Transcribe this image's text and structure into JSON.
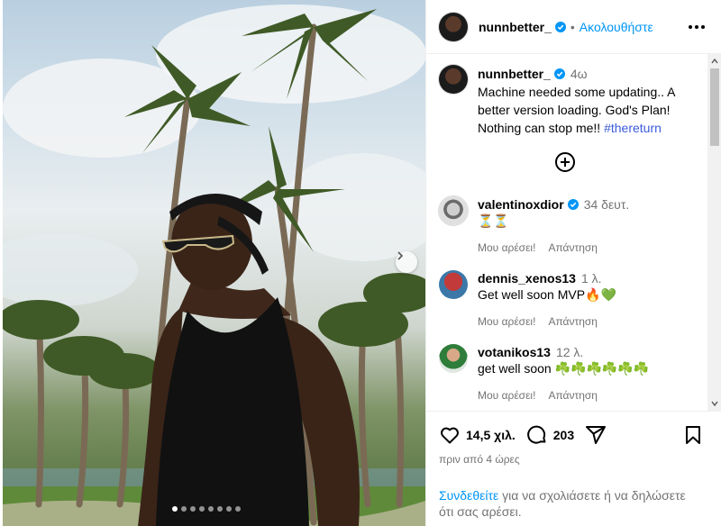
{
  "post": {
    "username": "nunnbetter_",
    "follow_label": "Ακολουθήστε",
    "follow_separator": "•",
    "caption": {
      "username": "nunnbetter_",
      "time": "4ω",
      "text": "Machine needed some updating.. A better version loading. God's Plan! Nothing can stop me!!",
      "hashtag": "#thereturn"
    },
    "carousel": {
      "slide_count": 8,
      "active_index": 0
    }
  },
  "comments": [
    {
      "username": "valentinoxdior",
      "verified": true,
      "time": "34 δευτ.",
      "text": "⏳⏳",
      "like_label": "Μου αρέσει!",
      "reply_label": "Απάντηση"
    },
    {
      "username": "dennis_xenos13",
      "verified": false,
      "time": "1 λ.",
      "text": "Get well soon MVP🔥💚",
      "like_label": "Μου αρέσει!",
      "reply_label": "Απάντηση"
    },
    {
      "username": "votanikos13",
      "verified": false,
      "time": "12 λ.",
      "text": "get well soon ☘️☘️☘️☘️☘️☘️",
      "like_label": "Μου αρέσει!",
      "reply_label": "Απάντηση"
    }
  ],
  "footer": {
    "likes": "14,5 χιλ.",
    "comments_count": "203",
    "posted_time": "πριν από 4 ώρες",
    "login_link": "Συνδεθείτε",
    "login_text": " για να σχολιάσετε ή να δηλώσετε ότι σας αρέσει."
  },
  "icons": {
    "like": "heart-icon",
    "comment": "comment-icon",
    "share": "paper-plane-icon",
    "save": "bookmark-icon",
    "more": "more-options-icon",
    "load_more": "plus-circle-icon",
    "next": "chevron-right-icon",
    "verified": "verified-badge-icon"
  },
  "colors": {
    "link": "#0095f6",
    "verified": "#0095f6",
    "muted": "#737373",
    "hashtag": "#3b5bdb"
  }
}
